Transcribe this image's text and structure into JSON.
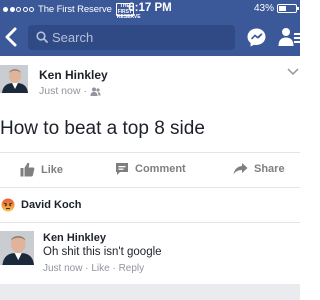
{
  "status_bar": {
    "carrier": "The First Reserve",
    "carrier_logo_text": "THE FIRST RESERVE",
    "time": "6:17 PM",
    "battery": "43%",
    "battery_level": 0.43
  },
  "nav": {
    "search_placeholder": "Search",
    "icons": [
      "back-icon",
      "search-icon",
      "messenger-icon",
      "friends-icon"
    ]
  },
  "post": {
    "author": "Ken Hinkley",
    "time": "Just now",
    "separator": "·",
    "privacy_icon": "friends-icon",
    "text": "How to beat a top 8 side"
  },
  "actions": {
    "like": "Like",
    "comment": "Comment",
    "share": "Share"
  },
  "reaction": {
    "icon": "angry-emoji-icon",
    "name": "David Koch"
  },
  "comment": {
    "author": "Ken Hinkley",
    "text": "Oh shit this isn't google",
    "meta": "Just now · Like · Reply"
  },
  "colors": {
    "facebook_blue": "#3b5998",
    "search_bg": "#2f4a85",
    "meta_gray": "#90949c",
    "action_gray": "#7f7f7f"
  }
}
